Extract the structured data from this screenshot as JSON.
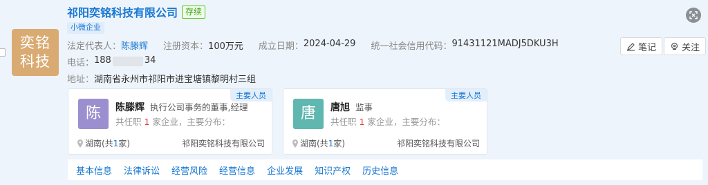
{
  "company": {
    "name": "祁阳奕铭科技有限公司",
    "status": "存续",
    "logo_line1": "奕铭",
    "logo_line2": "科技",
    "tag": "小微企业"
  },
  "info": {
    "legal_rep_label": "法定代表人：",
    "legal_rep": "陈滕辉",
    "capital_label": "注册资本：",
    "capital": "100万元",
    "founded_label": "成立日期：",
    "founded": "2024-04-29",
    "credit_label": "统一社会信用代码：",
    "credit": "91431121MADJ5DKU3H",
    "phone_label": "电话：",
    "phone_prefix": "188",
    "phone_suffix": "34",
    "address_label": "地址：",
    "address": "湖南省永州市祁阳市进宝塘镇黎明村三组"
  },
  "actions": {
    "note": "笔记",
    "follow": "关注"
  },
  "people": [
    {
      "tag": "主要人员",
      "avatar": "陈",
      "name": "陈滕辉",
      "role": "执行公司事务的董事,经理",
      "stat_pre": "共任职 ",
      "stat_num": "1",
      "stat_post": " 家企业，主要分布：",
      "region_pre": "湖南(共",
      "region_num": "1",
      "region_post": "家)",
      "company": "祁阳奕铭科技有限公司"
    },
    {
      "tag": "主要人员",
      "avatar": "唐",
      "name": "唐旭",
      "role": "监事",
      "stat_pre": "共任职 ",
      "stat_num": "1",
      "stat_post": " 家企业，主要分布：",
      "region_pre": "湖南(共",
      "region_num": "1",
      "region_post": "家)",
      "company": "祁阳奕铭科技有限公司"
    }
  ],
  "tabs": [
    "基本信息",
    "法律诉讼",
    "经营风险",
    "经营信息",
    "企业发展",
    "知识产权",
    "历史信息"
  ]
}
